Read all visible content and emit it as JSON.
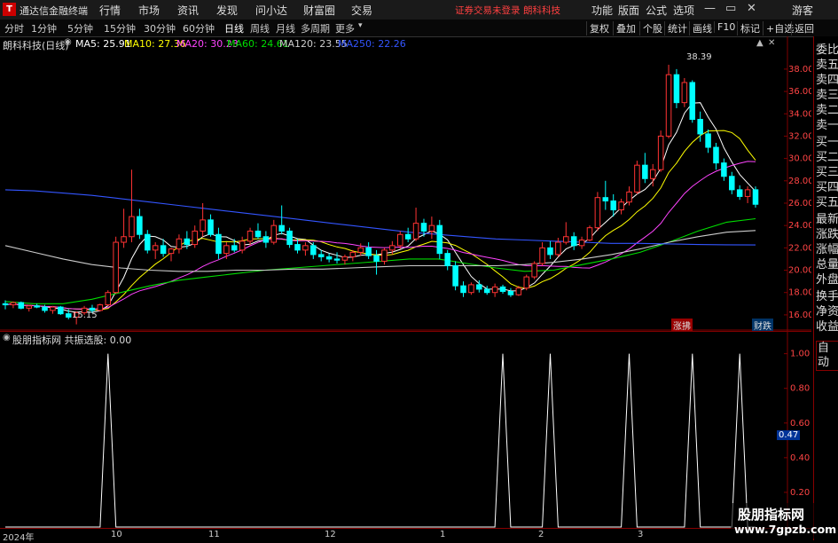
{
  "app": {
    "title": "通达信金融终端",
    "logo": "T"
  },
  "menu": [
    "行情",
    "市场",
    "资讯",
    "发现",
    "问小达",
    "财富圈",
    "交易"
  ],
  "login_status": "证券交易未登录",
  "stock_name_header": "朗科科技",
  "right_menu": [
    "功能",
    "版面",
    "公式",
    "选项"
  ],
  "guest": "游客",
  "periods": [
    {
      "label": "分时"
    },
    {
      "label": "1分钟"
    },
    {
      "label": "5分钟"
    },
    {
      "label": "15分钟"
    },
    {
      "label": "30分钟"
    },
    {
      "label": "60分钟"
    },
    {
      "label": "日线",
      "active": true
    },
    {
      "label": "周线"
    },
    {
      "label": "月线"
    },
    {
      "label": "多周期"
    },
    {
      "label": "更多"
    }
  ],
  "toolbar": [
    "复权",
    "叠加",
    "个股",
    "统计",
    "画线",
    "F10",
    "标记",
    "+自选",
    "返回"
  ],
  "chart_info": {
    "name": "朗科科技(日线)",
    "ma": [
      {
        "label": "MA5: 25.91",
        "color": "#ffffff"
      },
      {
        "label": "MA10: 27.36",
        "color": "#ffff00"
      },
      {
        "label": "MA20: 30.23",
        "color": "#ff44ff"
      },
      {
        "label": "MA60: 24.61",
        "color": "#00dd00"
      },
      {
        "label": "MA120: 23.55",
        "color": "#cccccc"
      },
      {
        "label": "MA250: 22.26",
        "color": "#3355ff"
      }
    ]
  },
  "annotations": {
    "high": "38.39",
    "low": "15.15",
    "zhangtu": "涨拂",
    "caie": "财跌"
  },
  "indicator": {
    "title": "股朋指标网  共振选股: 0.00"
  },
  "right_panel": [
    "委比",
    "卖五",
    "卖四",
    "卖三",
    "卖二",
    "卖一",
    "买一",
    "买二",
    "买三",
    "买四",
    "买五",
    "最新",
    "涨跌",
    "涨幅",
    "总量",
    "外盘",
    "换手",
    "净资",
    "收益",
    "自动"
  ],
  "indicator_current": "0.47",
  "watermark": {
    "line1": "股朋指标网",
    "line2": "www.7gpzb.com"
  },
  "colors": {
    "up": "#ff3333",
    "down": "#00ffff",
    "axis": "#800000"
  },
  "chart_data": [
    {
      "type": "candlestick",
      "title": "朗科科技(日线)",
      "y_ticks": [
        16,
        18,
        20,
        22,
        24,
        26,
        28,
        30,
        32,
        34,
        36,
        38
      ],
      "ylim": [
        14.8,
        39.5
      ],
      "x_ticks": [
        "2024年",
        "10",
        "11",
        "12",
        "1",
        "2",
        "3"
      ],
      "grid": false,
      "series": [
        {
          "name": "MA5",
          "value_last": 25.91
        },
        {
          "name": "MA10",
          "value_last": 27.36
        },
        {
          "name": "MA20",
          "value_last": 30.23
        },
        {
          "name": "MA60",
          "value_last": 24.61
        },
        {
          "name": "MA120",
          "value_last": 23.55
        },
        {
          "name": "MA250",
          "value_last": 22.26
        }
      ],
      "ohlc": [
        [
          17.0,
          17.3,
          16.5,
          16.9
        ],
        [
          16.9,
          17.2,
          16.6,
          17.1
        ],
        [
          17.1,
          17.2,
          16.5,
          16.6
        ],
        [
          16.6,
          16.9,
          16.3,
          16.8
        ],
        [
          16.8,
          17.0,
          16.6,
          16.7
        ],
        [
          16.7,
          16.9,
          16.2,
          16.4
        ],
        [
          16.4,
          16.8,
          16.1,
          16.7
        ],
        [
          16.7,
          16.8,
          16.0,
          16.1
        ],
        [
          16.1,
          16.5,
          15.6,
          15.8
        ],
        [
          15.8,
          16.3,
          15.15,
          16.2
        ],
        [
          16.2,
          16.8,
          16.0,
          16.6
        ],
        [
          16.6,
          16.9,
          16.2,
          16.4
        ],
        [
          16.4,
          17.0,
          16.3,
          16.9
        ],
        [
          16.9,
          18.2,
          16.8,
          18.0
        ],
        [
          18.0,
          23.0,
          17.9,
          22.5
        ],
        [
          22.5,
          25.5,
          22.0,
          23.0
        ],
        [
          23.0,
          29.0,
          22.5,
          24.8
        ],
        [
          24.8,
          25.5,
          22.8,
          23.2
        ],
        [
          23.2,
          23.6,
          21.5,
          21.8
        ],
        [
          21.8,
          22.5,
          21.0,
          22.2
        ],
        [
          22.2,
          22.8,
          21.2,
          21.5
        ],
        [
          21.5,
          22.0,
          20.8,
          21.9
        ],
        [
          21.9,
          23.2,
          21.5,
          22.8
        ],
        [
          22.8,
          23.5,
          21.9,
          22.3
        ],
        [
          22.3,
          24.0,
          22.0,
          23.5
        ],
        [
          23.5,
          26.0,
          23.0,
          24.5
        ],
        [
          24.5,
          25.0,
          23.0,
          23.2
        ],
        [
          23.2,
          23.8,
          21.0,
          21.5
        ],
        [
          21.5,
          22.5,
          21.0,
          22.2
        ],
        [
          22.2,
          22.8,
          21.6,
          21.8
        ],
        [
          21.8,
          23.0,
          21.5,
          22.6
        ],
        [
          22.6,
          23.8,
          22.2,
          23.5
        ],
        [
          23.5,
          24.2,
          22.8,
          23.0
        ],
        [
          23.0,
          23.5,
          22.0,
          22.5
        ],
        [
          22.5,
          24.5,
          22.3,
          24.0
        ],
        [
          24.0,
          25.8,
          23.2,
          23.5
        ],
        [
          23.5,
          23.8,
          22.0,
          22.3
        ],
        [
          22.3,
          22.8,
          21.5,
          21.8
        ],
        [
          21.8,
          22.5,
          21.3,
          22.2
        ],
        [
          22.2,
          22.5,
          21.0,
          21.4
        ],
        [
          21.4,
          21.8,
          20.8,
          21.2
        ],
        [
          21.2,
          21.5,
          20.7,
          21.0
        ],
        [
          21.0,
          21.6,
          20.6,
          20.9
        ],
        [
          20.9,
          21.4,
          20.5,
          21.2
        ],
        [
          21.2,
          21.8,
          20.8,
          21.6
        ],
        [
          21.6,
          22.4,
          21.3,
          22.0
        ],
        [
          22.0,
          22.5,
          21.0,
          21.3
        ],
        [
          21.3,
          21.8,
          19.6,
          20.8
        ],
        [
          20.8,
          22.0,
          20.5,
          21.8
        ],
        [
          21.8,
          22.6,
          21.4,
          22.2
        ],
        [
          22.2,
          23.5,
          21.9,
          23.2
        ],
        [
          23.2,
          23.8,
          22.5,
          22.8
        ],
        [
          22.8,
          25.6,
          22.6,
          24.2
        ],
        [
          24.2,
          24.6,
          23.0,
          23.5
        ],
        [
          23.5,
          24.8,
          22.8,
          24.0
        ],
        [
          24.0,
          24.5,
          21.0,
          21.5
        ],
        [
          21.5,
          21.8,
          20.0,
          20.4
        ],
        [
          20.4,
          20.8,
          18.2,
          18.6
        ],
        [
          18.6,
          19.0,
          17.6,
          18.0
        ],
        [
          18.0,
          18.9,
          17.8,
          18.7
        ],
        [
          18.7,
          19.1,
          18.0,
          18.3
        ],
        [
          18.3,
          18.6,
          17.8,
          18.0
        ],
        [
          18.0,
          18.8,
          17.6,
          18.5
        ],
        [
          18.5,
          18.7,
          17.9,
          18.1
        ],
        [
          18.1,
          18.4,
          17.6,
          17.8
        ],
        [
          17.8,
          18.6,
          17.7,
          18.4
        ],
        [
          18.4,
          19.6,
          18.2,
          19.4
        ],
        [
          19.4,
          20.8,
          19.2,
          20.6
        ],
        [
          20.6,
          22.5,
          20.4,
          22.0
        ],
        [
          22.0,
          22.6,
          21.0,
          21.4
        ],
        [
          21.4,
          22.9,
          21.2,
          22.5
        ],
        [
          22.5,
          24.3,
          22.3,
          23.0
        ],
        [
          23.0,
          23.4,
          21.8,
          22.2
        ],
        [
          22.2,
          23.0,
          21.9,
          22.7
        ],
        [
          22.7,
          24.0,
          22.6,
          23.8
        ],
        [
          23.8,
          27.0,
          23.5,
          26.5
        ],
        [
          26.5,
          28.0,
          25.4,
          26.2
        ],
        [
          26.2,
          26.8,
          24.8,
          25.4
        ],
        [
          25.4,
          26.4,
          25.0,
          26.1
        ],
        [
          26.1,
          27.5,
          25.8,
          27.0
        ],
        [
          27.0,
          29.8,
          26.8,
          29.4
        ],
        [
          29.4,
          30.5,
          27.8,
          28.2
        ],
        [
          28.2,
          29.5,
          27.5,
          29.0
        ],
        [
          29.0,
          32.5,
          28.8,
          32.0
        ],
        [
          32.0,
          38.39,
          31.8,
          37.5
        ],
        [
          37.5,
          38.0,
          34.5,
          35.0
        ],
        [
          35.0,
          37.2,
          34.6,
          36.8
        ],
        [
          36.8,
          37.0,
          33.2,
          33.5
        ],
        [
          33.5,
          34.2,
          31.5,
          32.2
        ],
        [
          32.2,
          32.6,
          30.5,
          31.0
        ],
        [
          31.0,
          31.4,
          29.0,
          29.6
        ],
        [
          29.6,
          30.0,
          28.0,
          28.4
        ],
        [
          28.4,
          28.8,
          26.8,
          27.2
        ],
        [
          27.2,
          27.6,
          26.3,
          26.6
        ],
        [
          26.6,
          27.5,
          26.0,
          27.2
        ],
        [
          27.2,
          27.5,
          25.6,
          25.9
        ]
      ]
    },
    {
      "type": "line",
      "title": "共振选股",
      "y_ticks": [
        0.2,
        0.4,
        0.6,
        0.8,
        1.0
      ],
      "ylim": [
        0,
        1.08
      ],
      "signal_days": [
        13,
        63,
        69,
        79,
        87,
        93
      ],
      "days": 96
    }
  ]
}
